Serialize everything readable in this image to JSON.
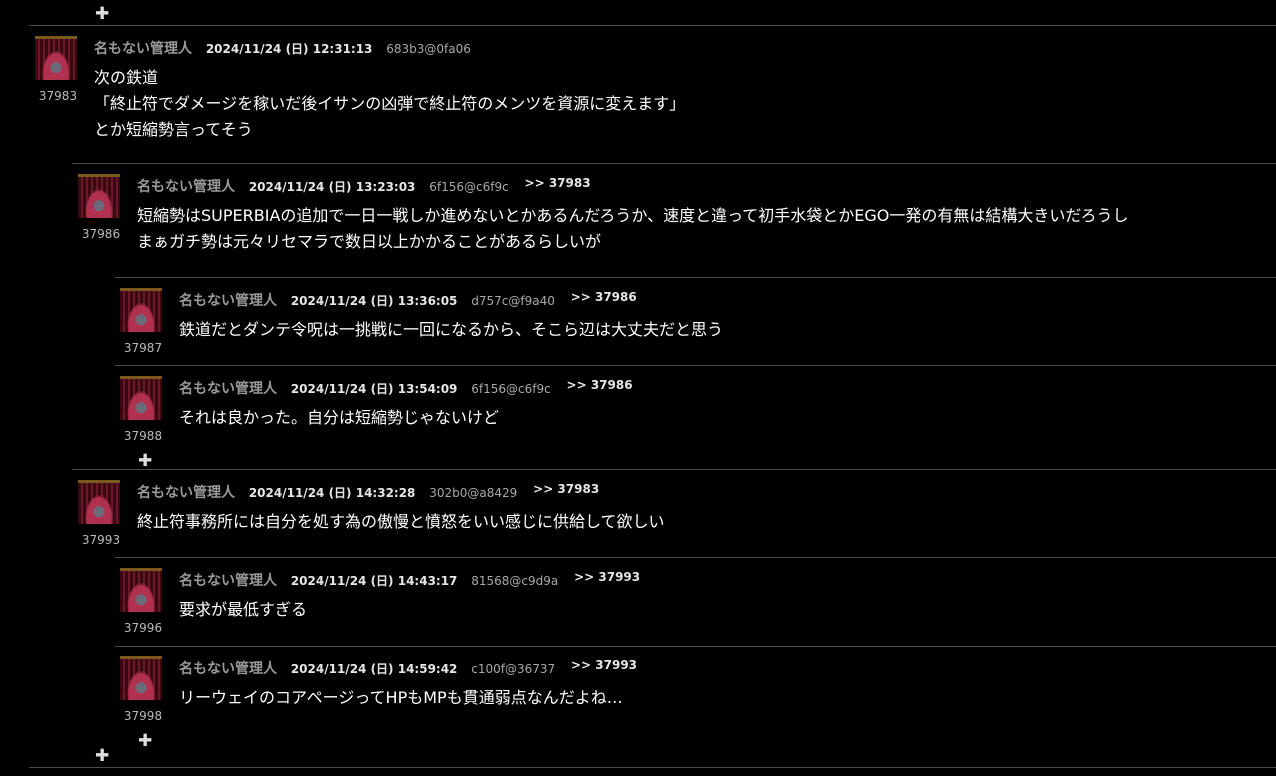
{
  "plus_glyph": "✚",
  "posts": [
    {
      "number": "37983",
      "name": "名もない管理人",
      "date": "2024/11/24 (日) 12:31:13",
      "id": "683b3@0fa06",
      "reply_to": "",
      "lines": [
        "次の鉄道",
        "「終止符でダメージを稼いだ後イサンの凶弾で終止符のメンツを資源に変えます」",
        "とか短縮勢言ってそう"
      ]
    },
    {
      "number": "37986",
      "name": "名もない管理人",
      "date": "2024/11/24 (日) 13:23:03",
      "id": "6f156@c6f9c",
      "reply_to": ">> 37983",
      "lines": [
        "短縮勢はSUPERBIAの追加で一日一戦しか進めないとかあるんだろうか、速度と違って初手水袋とかEGO一発の有無は結構大きいだろうし",
        "まぁガチ勢は元々リセマラで数日以上かかることがあるらしいが"
      ]
    },
    {
      "number": "37987",
      "name": "名もない管理人",
      "date": "2024/11/24 (日) 13:36:05",
      "id": "d757c@f9a40",
      "reply_to": ">> 37986",
      "lines": [
        "鉄道だとダンテ令呪は一挑戦に一回になるから、そこら辺は大丈夫だと思う"
      ]
    },
    {
      "number": "37988",
      "name": "名もない管理人",
      "date": "2024/11/24 (日) 13:54:09",
      "id": "6f156@c6f9c",
      "reply_to": ">> 37986",
      "lines": [
        "それは良かった。自分は短縮勢じゃないけど"
      ]
    },
    {
      "number": "37993",
      "name": "名もない管理人",
      "date": "2024/11/24 (日) 14:32:28",
      "id": "302b0@a8429",
      "reply_to": ">> 37983",
      "lines": [
        "終止符事務所には自分を処す為の傲慢と憤怒をいい感じに供給して欲しい"
      ]
    },
    {
      "number": "37996",
      "name": "名もない管理人",
      "date": "2024/11/24 (日) 14:43:17",
      "id": "81568@c9d9a",
      "reply_to": ">> 37993",
      "lines": [
        "要求が最低すぎる"
      ]
    },
    {
      "number": "37998",
      "name": "名もない管理人",
      "date": "2024/11/24 (日) 14:59:42",
      "id": "c100f@36737",
      "reply_to": ">> 37993",
      "lines": [
        "リーウェイのコアページってHPもMPも貫通弱点なんだよね…"
      ]
    }
  ]
}
